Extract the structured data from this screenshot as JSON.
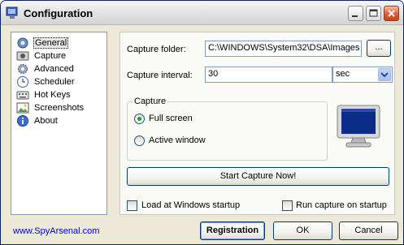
{
  "window": {
    "title": "Configuration"
  },
  "nav": {
    "items": [
      {
        "label": "General",
        "icon": "general-icon",
        "selected": true
      },
      {
        "label": "Capture",
        "icon": "capture-icon"
      },
      {
        "label": "Advanced",
        "icon": "advanced-icon"
      },
      {
        "label": "Scheduler",
        "icon": "scheduler-icon"
      },
      {
        "label": "Hot Keys",
        "icon": "hot-keys-icon"
      },
      {
        "label": "Screenshots",
        "icon": "screenshots-icon"
      },
      {
        "label": "About",
        "icon": "about-icon"
      }
    ]
  },
  "general": {
    "capture_folder_label": "Capture folder:",
    "capture_folder_value": "C:\\WINDOWS\\System32\\DSA\\Images",
    "browse_label": "...",
    "capture_interval_label": "Capture interval:",
    "capture_interval_value": "30",
    "interval_unit": "sec",
    "group_label": "Capture",
    "full_screen_label": "Full screen",
    "active_window_label": "Active window",
    "selected_mode": "Full screen",
    "start_button_label": "Start Capture Now!",
    "load_startup_label": "Load at Windows startup",
    "load_startup_checked": false,
    "run_capture_label": "Run capture on startup",
    "run_capture_checked": false
  },
  "footer": {
    "link_text": "www.SpyArsenal.com",
    "registration_label": "Registration",
    "ok_label": "OK",
    "cancel_label": "Cancel"
  },
  "colors": {
    "link": "#0000cc",
    "title_bar": "#e4e4e4",
    "selected_radio": "#21a121"
  }
}
